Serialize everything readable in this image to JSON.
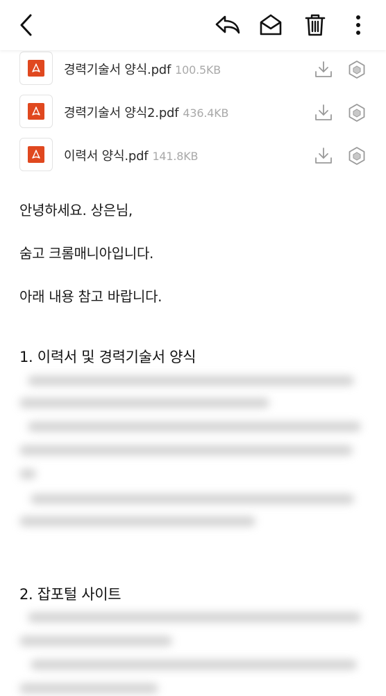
{
  "toolbar": {
    "back": "chevron-left-icon",
    "reply": "reply-icon",
    "mark_read": "envelope-open-icon",
    "delete": "trash-icon",
    "more": "more-vertical-icon"
  },
  "attachments": [
    {
      "name": "경력기술서 양식.pdf",
      "size": "100.5KB"
    },
    {
      "name": "경력기술서 양식2.pdf",
      "size": "436.4KB"
    },
    {
      "name": "이력서 양식.pdf",
      "size": "141.8KB"
    }
  ],
  "message": {
    "greeting": "안녕하세요. 상은님,",
    "intro": "숨고 크롬매니아입니다.",
    "request": "아래 내용 참고 바랍니다.",
    "sections": [
      {
        "heading": "1. 이력서 및 경력기술서 양식"
      },
      {
        "heading": "2. 잡포털 사이트"
      }
    ]
  },
  "colors": {
    "pdf_red": "#e0481f",
    "text": "#1a1a1a",
    "muted": "#a9a9a9",
    "icon": "#9a9a9a"
  }
}
